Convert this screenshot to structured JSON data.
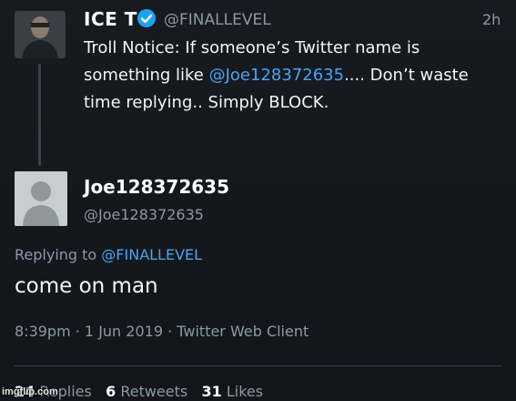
{
  "original_tweet": {
    "display_name": "ICE T",
    "handle": "@FINALLEVEL",
    "time": "2h",
    "text_part1": "Troll Notice:  If someone’s Twitter name is something like ",
    "text_mention": "@Joe128372635",
    "text_part2": ".... Don’t waste time replying..  Simply BLOCK.",
    "avatar_icon": "user-photo-avatar",
    "verified_icon": "verified-badge-icon"
  },
  "reply_tweet": {
    "display_name": "Joe128372635",
    "handle": "@Joe128372635",
    "replying_prefix": "Replying to ",
    "replying_to": "@FINALLEVEL",
    "text": "come on man",
    "timestamp": "8:39pm · 1 Jun 2019 · Twitter Web Client",
    "avatar_icon": "default-egg-avatar"
  },
  "stats": {
    "replies_count": "24",
    "replies_label": "Replies",
    "retweets_count": "6",
    "retweets_label": "Retweets",
    "likes_count": "31",
    "likes_label": "Likes"
  },
  "watermark": "imgflip.com",
  "colors": {
    "background": "#15191f",
    "link": "#4aa3f0",
    "secondary_text": "#8b98a5",
    "verified": "#1da1f2"
  }
}
